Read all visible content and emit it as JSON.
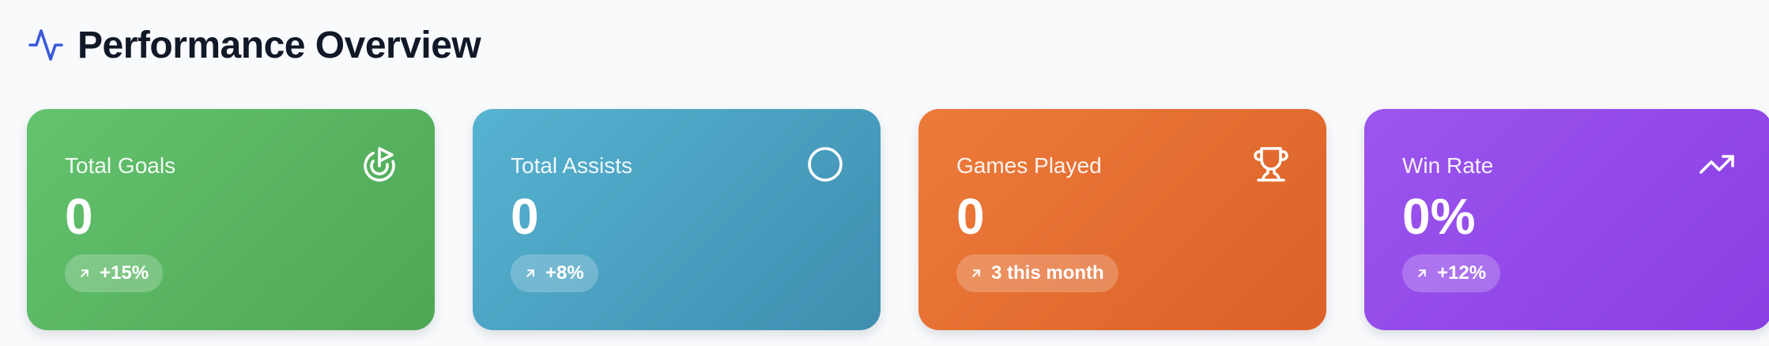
{
  "header": {
    "title": "Performance Overview",
    "icon": "activity-icon",
    "icon_color": "#3b5bdb"
  },
  "cards": [
    {
      "label": "Total Goals",
      "value": "0",
      "badge": "+15%",
      "icon": "target-goal-icon",
      "color": "#5bb865"
    },
    {
      "label": "Total Assists",
      "value": "0",
      "badge": "+8%",
      "icon": "circle-icon",
      "color": "#4aa3c6"
    },
    {
      "label": "Games Played",
      "value": "0",
      "badge": "3 this month",
      "icon": "trophy-icon",
      "color": "#e66e31"
    },
    {
      "label": "Win Rate",
      "value": "0%",
      "badge": "+12%",
      "icon": "trending-up-icon",
      "color": "#934ae9"
    }
  ]
}
